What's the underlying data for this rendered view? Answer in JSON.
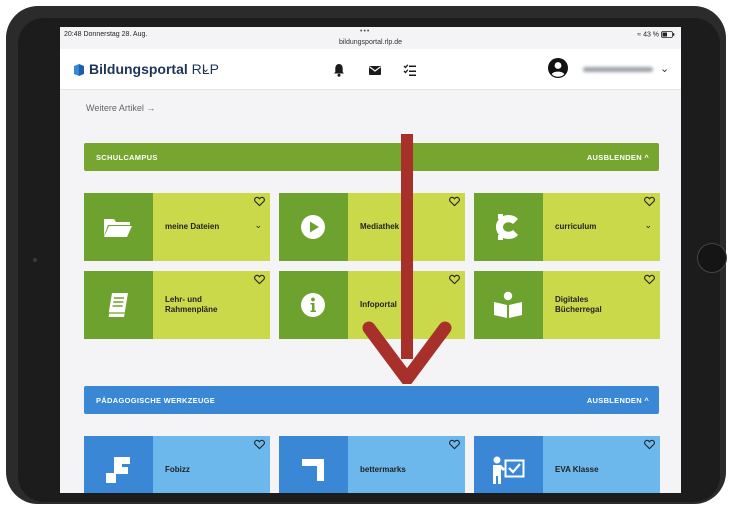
{
  "status_bar": {
    "time": "20:48",
    "date": "Donnerstag 28. Aug.",
    "dots": "•••",
    "url": "bildungsportal.rlp.de",
    "battery": "43 %"
  },
  "header": {
    "brand_bold": "Bildungsportal",
    "brand_light": " RLP",
    "chevron": "⌄",
    "icons": [
      "bell-icon",
      "mail-icon",
      "checklist-icon",
      "user-avatar-icon"
    ]
  },
  "more_articles": "Weitere Artikel →",
  "sections": [
    {
      "title": "SCHULCAMPUS",
      "toggle": "AUSBLENDEN ^",
      "bar_color": "#76a530",
      "tiles": [
        {
          "label": "meine Dateien",
          "icon": "folder-icon",
          "chevron": "⌄"
        },
        {
          "label": "Mediathek",
          "icon": "play-icon"
        },
        {
          "label": "curriculum",
          "icon": "curriculum-icon",
          "chevron": "⌄"
        },
        {
          "label": "Lehr- und Rahmenpläne",
          "line1": "Lehr- und",
          "line2": "Rahmenpläne",
          "icon": "book-icon"
        },
        {
          "label": "Infoportal",
          "icon": "info-icon"
        },
        {
          "label": "Digitales Bücherregal",
          "line1": "Digitales",
          "line2": "Bücherregal",
          "icon": "reader-icon"
        }
      ],
      "icon_color": "#6ea22e",
      "tile_color": "#cad94a"
    },
    {
      "title": "PÄDAGOGISCHE WERKZEUGE",
      "toggle": "AUSBLENDEN ^",
      "bar_color": "#3a87d6",
      "tiles": [
        {
          "label": "Fobizz",
          "icon": "fobizz-icon"
        },
        {
          "label": "bettermarks",
          "icon": "bettermarks-icon"
        },
        {
          "label": "EVA Klasse",
          "icon": "teacher-board-icon"
        }
      ],
      "icon_color": "#3a87d6",
      "tile_color": "#6cb8ec"
    }
  ],
  "overlay_arrow_color": "#a8302b"
}
